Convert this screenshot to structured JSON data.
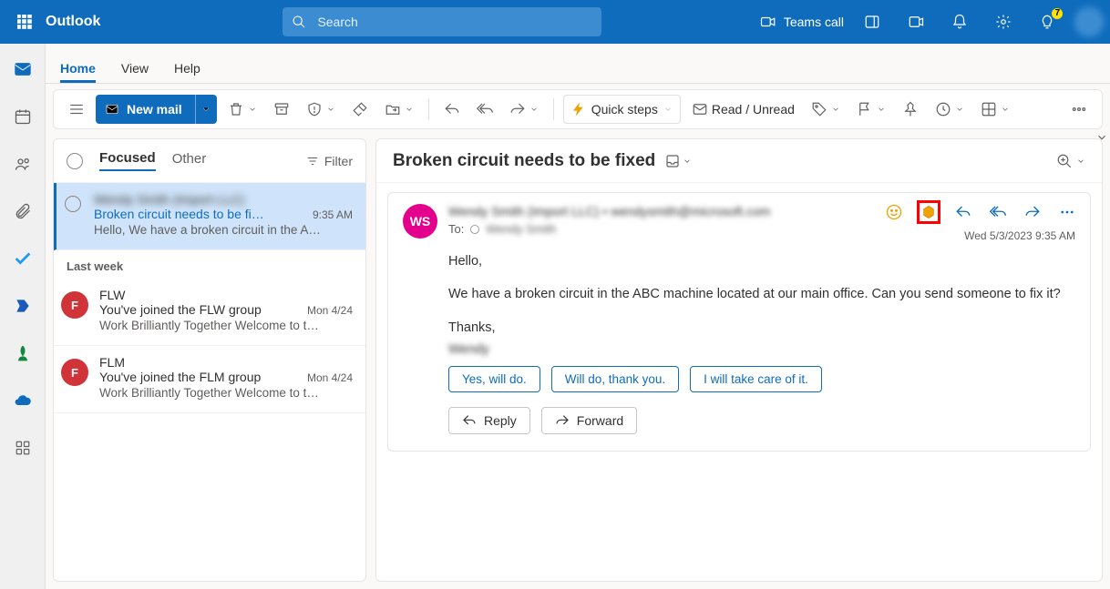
{
  "app": {
    "name": "Outlook",
    "search_placeholder": "Search"
  },
  "topright": {
    "teams_call": "Teams call",
    "tips_badge": "7"
  },
  "tabs": {
    "home": "Home",
    "view": "View",
    "help": "Help"
  },
  "ribbon": {
    "new_mail": "New mail",
    "quick_steps": "Quick steps",
    "read_unread": "Read / Unread"
  },
  "list": {
    "focused": "Focused",
    "other": "Other",
    "filter": "Filter",
    "section_lastweek": "Last week",
    "items": [
      {
        "sender": "Wendy Smith (Import LLC)",
        "subject": "Broken circuit needs to be fi…",
        "time": "9:35 AM",
        "preview": "Hello, We have a broken circuit in the A…"
      },
      {
        "sender": "FLW",
        "subject": "You've joined the FLW group",
        "time": "Mon 4/24",
        "preview": "Work Brilliantly Together Welcome to t…",
        "avatar": "F"
      },
      {
        "sender": "FLM",
        "subject": "You've joined the FLM group",
        "time": "Mon 4/24",
        "preview": "Work Brilliantly Together Welcome to t…",
        "avatar": "F"
      }
    ]
  },
  "read": {
    "title": "Broken circuit needs to be fixed",
    "from_avatar": "WS",
    "from_line": "Wendy Smith (Import LLC) • wendysmith@microsoft.com",
    "to_label": "To:",
    "to_value": "Wendy Smith",
    "timestamp": "Wed 5/3/2023 9:35 AM",
    "body": {
      "greeting": "Hello,",
      "para": "We have a broken circuit in the ABC machine located at   our main office. Can you send someone to fix it?",
      "thanks": "Thanks,",
      "signature": "Wendy"
    },
    "suggestions": [
      "Yes, will do.",
      "Will do, thank you.",
      "I will take care of it."
    ],
    "actions": {
      "reply": "Reply",
      "forward": "Forward"
    }
  }
}
